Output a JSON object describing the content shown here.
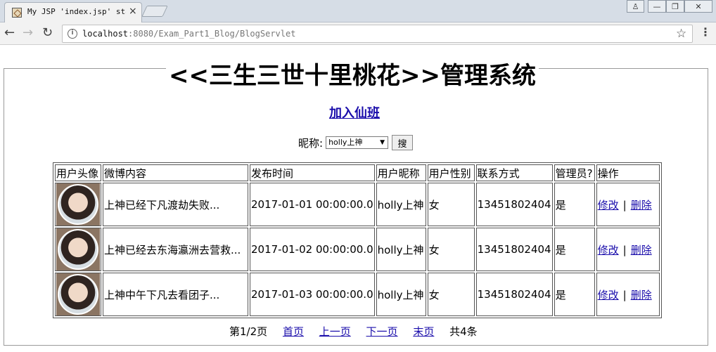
{
  "browser": {
    "tab_title": "My JSP 'index.jsp' sta",
    "tab_close": "×",
    "url_host": "localhost",
    "url_path": ":8080/Exam_Part1_Blog/BlogServlet",
    "window_buttons": {
      "user": "♙",
      "minimize": "—",
      "maximize": "❐",
      "close": "✕"
    },
    "nav": {
      "back": "←",
      "forward": "→",
      "reload": "↻"
    },
    "info": "i",
    "star": "☆",
    "menu": "⋮"
  },
  "page": {
    "legend": "<<三生三世十里桃花>>管理系统",
    "join_link": "加入仙班",
    "search": {
      "label": "昵称:",
      "selected": "holly上神",
      "button": "搜"
    }
  },
  "table": {
    "headers": [
      "用户头像",
      "微博内容",
      "发布时间",
      "用户昵称",
      "用户性别",
      "联系方式",
      "管理员?",
      "操作"
    ],
    "rows": [
      {
        "content": "上神已经下凡渡劫失败...",
        "time": "2017-01-01 00:00:00.0",
        "nickname": "holly上神",
        "gender": "女",
        "phone": "13451802404",
        "admin": "是",
        "edit": "修改",
        "sep": "|",
        "delete": "删除"
      },
      {
        "content": "上神已经去东海瀛洲去营救...",
        "time": "2017-01-02 00:00:00.0",
        "nickname": "holly上神",
        "gender": "女",
        "phone": "13451802404",
        "admin": "是",
        "edit": "修改",
        "sep": "|",
        "delete": "删除"
      },
      {
        "content": "上神中午下凡去看团子...",
        "time": "2017-01-03 00:00:00.0",
        "nickname": "holly上神",
        "gender": "女",
        "phone": "13451802404",
        "admin": "是",
        "edit": "修改",
        "sep": "|",
        "delete": "删除"
      }
    ]
  },
  "pager": {
    "status": "第1/2页",
    "first": "首页",
    "prev": "上一页",
    "next": "下一页",
    "last": "末页",
    "total": "共4条"
  }
}
